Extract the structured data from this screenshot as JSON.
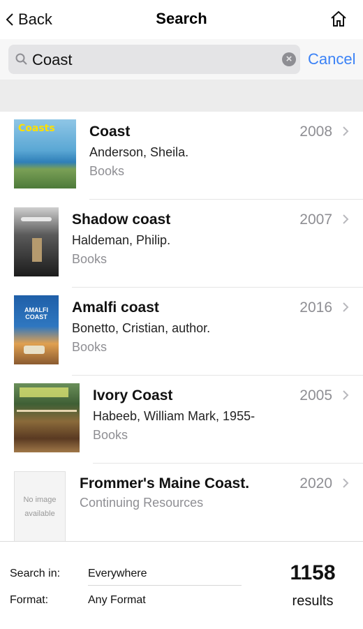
{
  "nav": {
    "back_label": "Back",
    "title": "Search"
  },
  "search": {
    "value": "Coast",
    "cancel_label": "Cancel"
  },
  "results": [
    {
      "title": "Coast",
      "author": "Anderson, Sheila.",
      "type": "Books",
      "year": "2008",
      "cover_text": "Coasts"
    },
    {
      "title": "Shadow coast",
      "author": "Haldeman, Philip.",
      "type": "Books",
      "year": "2007"
    },
    {
      "title": "Amalfi coast",
      "author": "Bonetto, Cristian, author.",
      "type": "Books",
      "year": "2016",
      "cover_text": "AMALFI COAST"
    },
    {
      "title": "Ivory Coast",
      "author": "Habeeb, William Mark, 1955-",
      "type": "Books",
      "year": "2005"
    },
    {
      "title": "Frommer's Maine Coast.",
      "type": "Continuing Resources",
      "year": "2020",
      "cover_text": "No image available"
    }
  ],
  "filters": {
    "search_in_label": "Search in:",
    "search_in_value": "Everywhere",
    "format_label": "Format:",
    "format_value": "Any Format"
  },
  "summary": {
    "count": "1158",
    "label": "results"
  },
  "colors": {
    "accent": "#3b82f6",
    "secondary_text": "#8e8e93",
    "search_bg": "#e4e4e6"
  }
}
